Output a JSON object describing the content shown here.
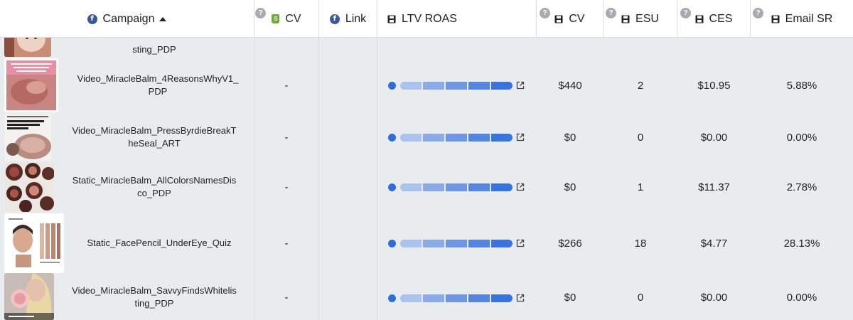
{
  "header": {
    "campaign_label": "Campaign",
    "cv_shop_label": "CV",
    "link_label": "Link",
    "ltv_roas_label": "LTV ROAS",
    "cv_label": "CV",
    "esu_label": "ESU",
    "ces_label": "CES",
    "email_sr_label": "Email SR",
    "help_glyph": "?",
    "fb_glyph": "f",
    "shop_glyph": "S"
  },
  "colors": {
    "bar_dot": "#2f6ed8",
    "bar_segments": [
      "#a9c2ee",
      "#8aabe8",
      "#6e96e4",
      "#5585e2",
      "#3774e0"
    ],
    "body_bg": "#e9ecef"
  },
  "partial_row": {
    "name": "sting_PDP",
    "thumbnail": "baby-photo"
  },
  "rows": [
    {
      "name": "Video_MiracleBalm_4ReasonsWhyV1_PDP",
      "name_line1": "Video_MiracleBalm_4ReasonsWhyV1_",
      "name_line2": "PDP",
      "link": "-",
      "ltv_roas": 1.0,
      "cv": "$440",
      "esu": "2",
      "ces": "$10.95",
      "email_sr": "5.88%",
      "thumbnail": "pink-balm-ad",
      "thumb_text": "4 Reasons Why Miracle Balm is The Secret to No-Makeup Makeup"
    },
    {
      "name": "Video_MiracleBalm_PressByrdieBreakTheSeal_ART",
      "name_line1": "Video_MiracleBalm_PressByrdieBreakT",
      "name_line2": "heSeal_ART",
      "link": "-",
      "ltv_roas": 1.0,
      "cv": "$0",
      "esu": "0",
      "ces": "$0.00",
      "email_sr": "0.00%",
      "thumbnail": "byrdie-article",
      "thumb_text": "A Complete Guide to Every Jones Road Beauty Product"
    },
    {
      "name": "Static_MiracleBalm_AllColorsNamesDisco_PDP",
      "name_line1": "Static_MiracleBalm_AllColorsNamesDis",
      "name_line2": "co_PDP",
      "link": "-",
      "ltv_roas": 1.0,
      "cv": "$0",
      "esu": "1",
      "ces": "$11.37",
      "email_sr": "2.78%",
      "thumbnail": "balm-pots"
    },
    {
      "name": "Static_FacePencil_UnderEye_Quiz",
      "name_line1": "Static_FacePencil_UnderEye_Quiz",
      "name_line2": "",
      "link": "-",
      "ltv_roas": 1.0,
      "cv": "$266",
      "esu": "18",
      "ces": "$4.77",
      "email_sr": "28.13%",
      "thumbnail": "face-pencil-swatches"
    },
    {
      "name": "Video_MiracleBalm_SavvyFindsWhitelisting_PDP",
      "name_line1": "Video_MiracleBalm_SavvyFindsWhitelis",
      "name_line2": "ting_PDP",
      "link": "-",
      "ltv_roas": 1.0,
      "cv": "$0",
      "esu": "0",
      "ces": "$0.00",
      "email_sr": "0.00%",
      "thumbnail": "creator-video"
    }
  ]
}
